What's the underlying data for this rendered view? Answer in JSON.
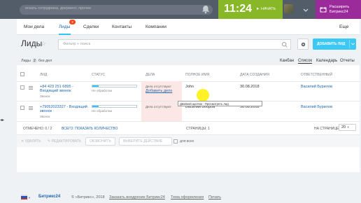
{
  "topbar": {
    "search_placeholder": "искать сотрудника, документ, прочее",
    "clock_time": "11:24",
    "clock_start": "► НАЧАТЬ",
    "upgrade_line1": "Расширить",
    "upgrade_line2": "Битрикс24"
  },
  "menu": {
    "items": [
      "Мои дела",
      "Лиды",
      "Сделки",
      "Контакты",
      "Компании"
    ],
    "leads_badge": "2",
    "more": "Еще"
  },
  "page": {
    "title": "Лиды",
    "filter_placeholder": "Фильтр + поиск",
    "add_button": "ДОБАВИТЬ ЛИД",
    "count_prefix": "Лиды",
    "count": "2",
    "count_suffix": "без дел"
  },
  "views": [
    "Канбан",
    "Список",
    "Календарь",
    "Отчеты"
  ],
  "grid": {
    "headers": [
      "ЛИД",
      "СТАТУС",
      "ДЕЛА",
      "ПОЛНОЕ ИМЯ",
      "ДАТА СОЗДАНИЯ",
      "ОТВЕТСТВЕННЫЙ"
    ],
    "rows": [
      {
        "lead_title": "+84 423 251 6895 - Входящий звонок",
        "lead_source": "Звонок",
        "status": "Не обработан",
        "status_progress": 0.15,
        "deal_status": "Дела отсутствуют",
        "deal_add": "Добавить дело",
        "name": "John",
        "date": "30.08.2018",
        "owner": "Василий Бурилов"
      },
      {
        "lead_title": "+79052023327 - Входящий звонок",
        "lead_source": "Звонок",
        "status": "Не обработан",
        "status_progress": 0.15,
        "deal_status": "Дела отсутствуют",
        "deal_add": "",
        "name": "Василий Бобров",
        "date": "30.08.2018",
        "owner": "Василий Бурилов"
      }
    ],
    "tooltip": "Двойной щелчок - Просмотреть лид"
  },
  "footer_grid": {
    "marked": "ОТМЕЧЕНО: 0 / 2",
    "total": "ВСЕГО: ПОКАЗАТЬ КОЛИЧЕСТВО",
    "pages": "СТРАНИЦЫ: 1",
    "per_page_label": "НА СТРАНИЦЕ:",
    "per_page": "20"
  },
  "actions": {
    "delete": "✕ УДАЛИТЬ",
    "edit": "✎ РЕДАКТИРОВАТЬ",
    "call": "ОБЗВОНИТЬ",
    "choose": "ВЫБЕРИТЕ ДЕЙСТВИЕ",
    "for_all": "для всех"
  },
  "footer": {
    "brand": "Битрикс24",
    "copyright": "© «Битрикс», 2018",
    "order": "Заказать внедрение Битрикс24",
    "theme": "Тема оформления",
    "print": "Печать"
  },
  "colors": {
    "topbar": "#535c69",
    "clock": "#88b827",
    "upgrade": "#9b2a9b",
    "accent": "#2fc6f6",
    "link": "#2067b0"
  }
}
